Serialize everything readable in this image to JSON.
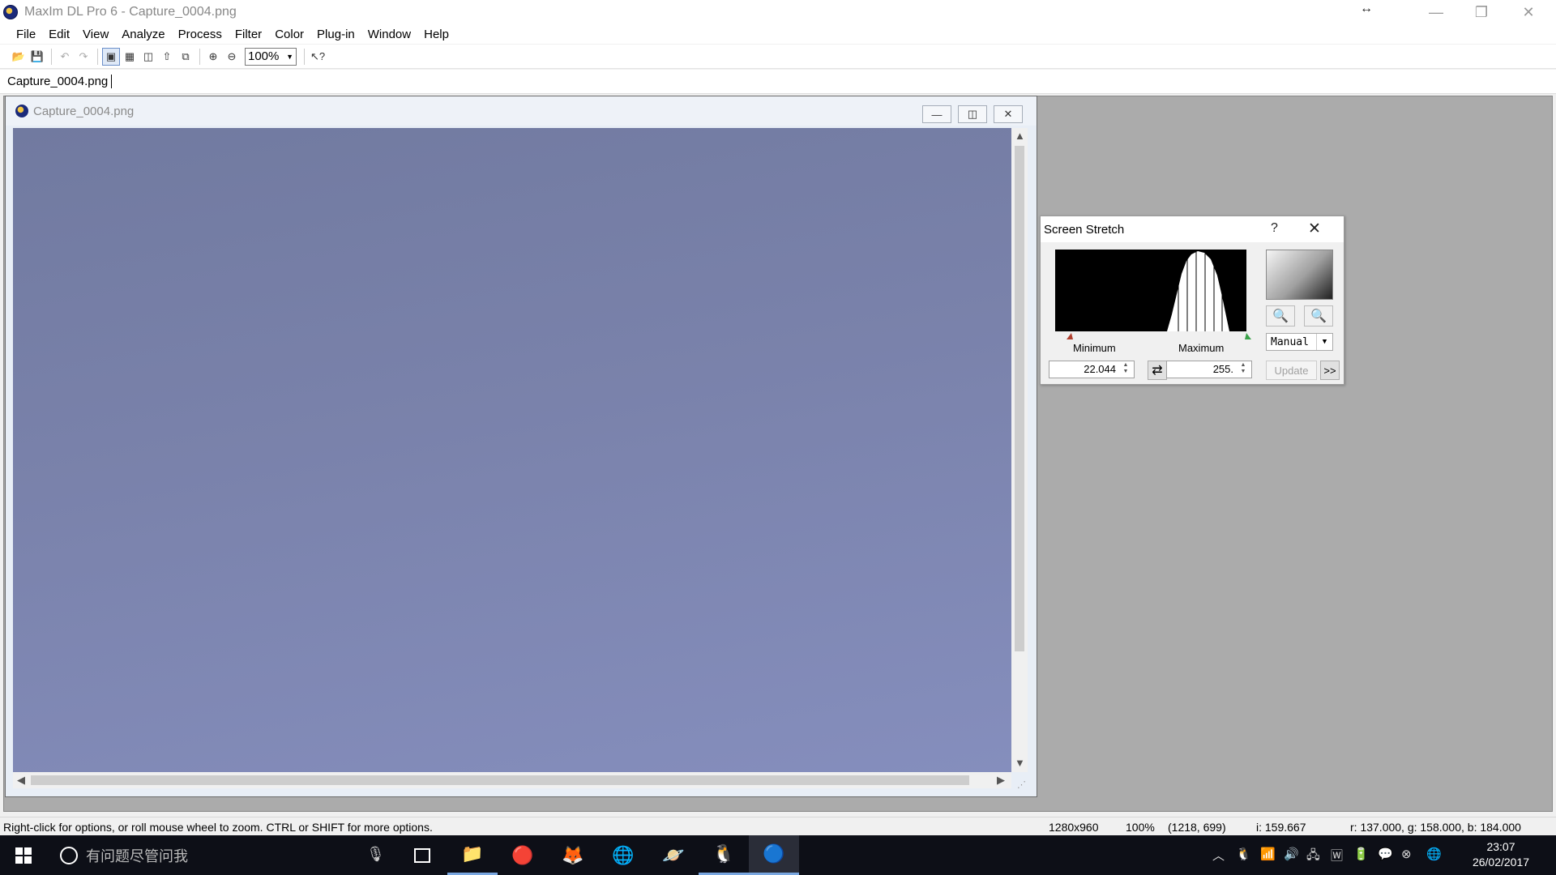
{
  "window": {
    "title": "MaxIm DL Pro 6 - Capture_0004.png",
    "controls": {
      "minimize": "—",
      "restore": "❐",
      "close": "✕"
    }
  },
  "menu": [
    "File",
    "Edit",
    "View",
    "Analyze",
    "Process",
    "Filter",
    "Color",
    "Plug-in",
    "Window",
    "Help"
  ],
  "toolbar": {
    "zoom_value": "100%",
    "icons": [
      "open-icon",
      "save-icon",
      "undo-icon",
      "redo-icon",
      "image-view-icon",
      "gallery-icon",
      "flip-icon",
      "pin-icon",
      "screen-icon",
      "zoom-in-icon",
      "zoom-out-icon",
      "help-pointer-icon"
    ]
  },
  "tabs": {
    "active": "Capture_0004.png"
  },
  "child_window": {
    "title": "Capture_0004.png",
    "image_color_top": "#717aa0",
    "image_color_bottom": "#858ebd"
  },
  "stretch": {
    "title": "Screen Stretch",
    "help": "?",
    "min_label": "Minimum",
    "max_label": "Maximum",
    "min_value": "22.044",
    "max_value": "255.",
    "mode": "Manual",
    "update_label": "Update",
    "more_label": ">>"
  },
  "statusbar": {
    "hint": "Right-click for options, or roll mouse wheel to zoom. CTRL or SHIFT for more options.",
    "dimensions": "1280x960",
    "zoom": "100%",
    "cursor": "(1218, 699)",
    "intensity": "i:   159.667",
    "rgb": "r:   137.000,  g:   158.000,  b:   184.000"
  },
  "taskbar": {
    "search_placeholder": "有问题尽管问我",
    "time": "23:07",
    "date": "26/02/2017"
  }
}
